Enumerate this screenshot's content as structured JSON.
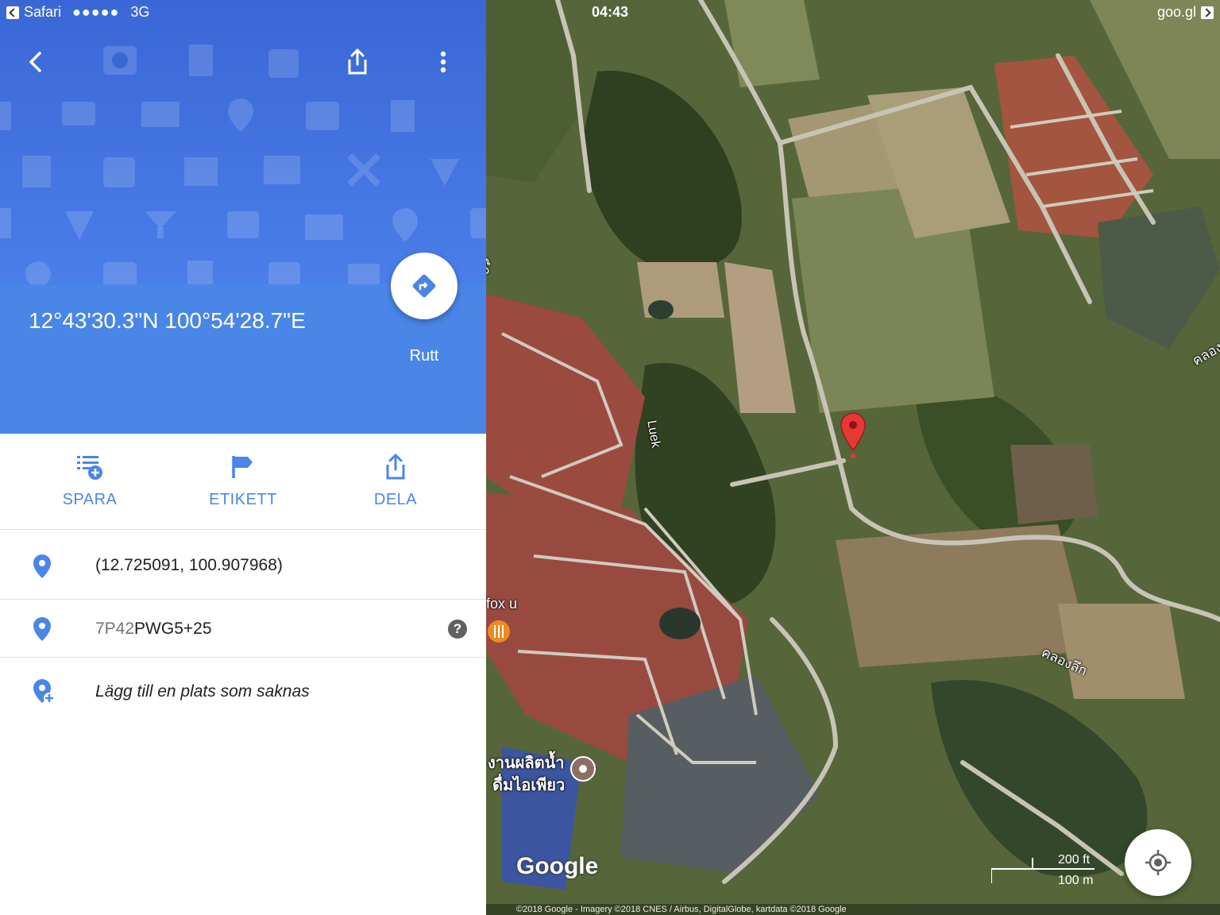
{
  "status_bar": {
    "back_app": "Safari",
    "signal": "●●●●●",
    "network": "3G",
    "time": "04:43",
    "url_hint": "goo.gl"
  },
  "place": {
    "title": "12°43'30.3\"N 100°54'28.7\"E",
    "route_label": "Rutt"
  },
  "actions": [
    {
      "label": "SPARA",
      "icon": "save-list-icon"
    },
    {
      "label": "ETIKETT",
      "icon": "flag-icon"
    },
    {
      "label": "DELA",
      "icon": "share-icon"
    }
  ],
  "details": {
    "latlng": "(12.725091, 100.907968)",
    "pluscode_prefix": "7P42",
    "pluscode_main": "PWG5+25",
    "add_missing": "Lägg till en plats som saknas"
  },
  "map": {
    "labels": {
      "luek": "Luek",
      "fox": "fox u",
      "thai_place": "งานผลิตน้ำ",
      "thai_place2": "ดื่มไอเพียว",
      "khlong": "คลองลึก",
      "khlong_right": "คลอง",
      "left_edge": "งลึก"
    },
    "logo": "Google",
    "scale_ft": "200 ft",
    "scale_m": "100 m",
    "copyright": "©2018 Google - Imagery ©2018 CNES / Airbus, DigitalGlobe, kartdata ©2018 Google"
  },
  "colors": {
    "accent": "#4a86e8",
    "hero_top": "#3b67d6",
    "pin_red": "#e53935"
  }
}
